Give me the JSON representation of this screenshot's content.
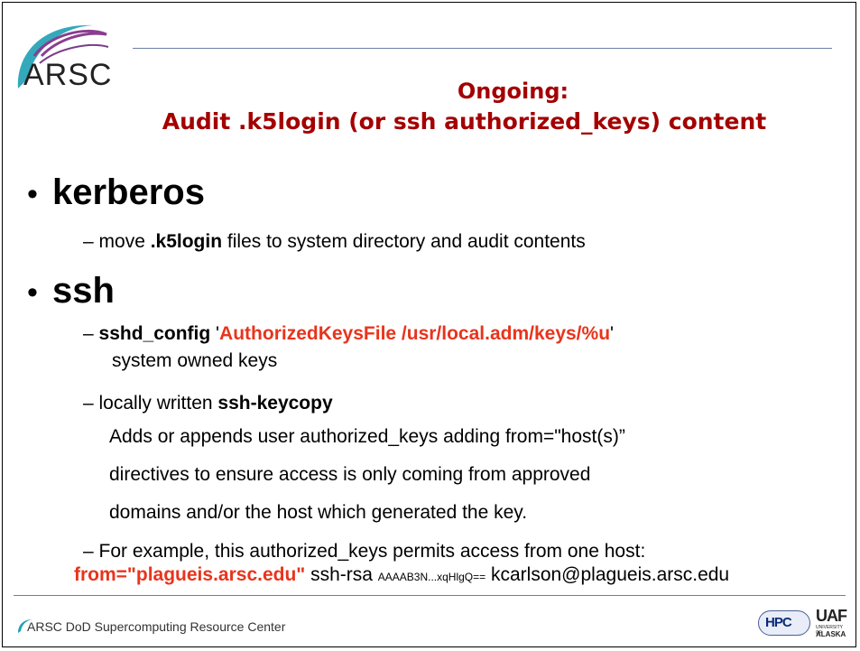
{
  "logo": {
    "text": "ARSC"
  },
  "title": {
    "line1": "Ongoing:",
    "line2": "Audit .k5login (or ssh authorized_keys) content"
  },
  "bullets": {
    "kerberos": {
      "label": "kerberos",
      "sub1": {
        "bold": ".k5login",
        "pre": "move ",
        "post": " files to system directory and audit contents"
      }
    },
    "ssh": {
      "label": "ssh",
      "sub1": {
        "bold": "sshd_config",
        "quote_open": " '",
        "red": "AuthorizedKeysFile /usr/local.adm/keys/%u",
        "quote_close": "'"
      },
      "sub1_line2": "system owned keys",
      "sub2": {
        "pre": "locally written ",
        "bold": "ssh-keycopy"
      },
      "sub2_lines": [
        "Adds or appends user authorized_keys adding from=\"host(s)”",
        "directives to ensure access is only coming from approved",
        "domains and/or the host which generated the key."
      ],
      "sub3": "For example, this authorized_keys permits access from one host:",
      "example": {
        "red": "from=\"plagueis.arsc.edu\"",
        "mid": " ssh-rsa ",
        "small": "AAAAB3N...xqHlgQ==",
        "tail": " kcarlson@plagueis.arsc.edu"
      }
    }
  },
  "footer": {
    "text": "ARSC DoD Supercomputing Resource Center",
    "hpc_logo": "HPC",
    "uaf_logo": "UAF",
    "uaf_sub": "UNIVERSITY OF",
    "uaf_state": "ALASKA"
  },
  "colors": {
    "title": "#a40000",
    "accent_red": "#e8341c",
    "rule": "#6a7fa6"
  },
  "icons": {
    "bullet": "bullet-dot",
    "dash": "en-dash"
  }
}
